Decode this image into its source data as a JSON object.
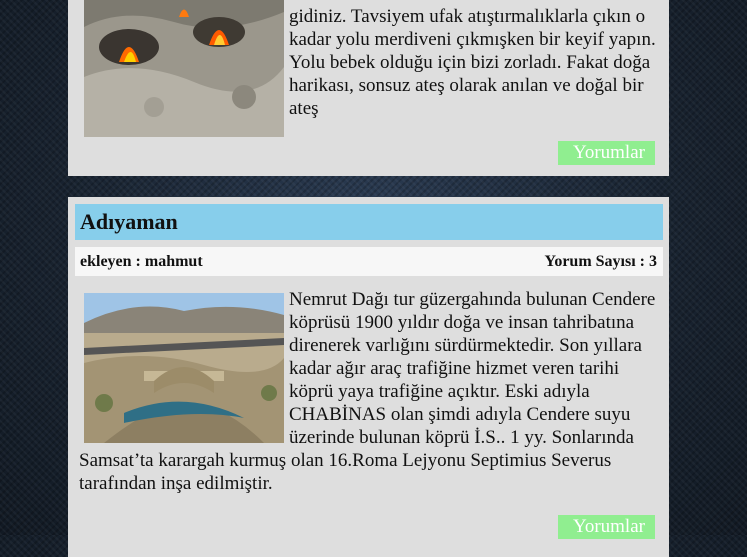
{
  "posts": [
    {
      "body": "gidiniz. Tavsiyem ufak atıştırmalıklarla çıkın o kadar yolu merdiveni çıkmışken bir keyif yapın. Yolu bebek olduğu için bizi zorladı. Fakat doğa harikası, sonsuz ateş olarak anılan ve doğal bir ateş",
      "comments_label": "Yorumlar"
    },
    {
      "title": "Adıyaman",
      "author": "ekleyen : mahmut",
      "comment_count": "Yorum Sayısı : 3",
      "body": "Nemrut Dağı tur güzergahında bulunan Cendere köprüsü 1900 yıldır doğa ve insan tahribatına direnerek varlığını sürdürmektedir. Son yıllara kadar ağır araç trafiğine hizmet veren tarihi köprü yaya trafiğine açıktır. Eski adıyla CHABİNAS olan şimdi adıyla Cendere suyu üzerinde bulunan köprü İ.S.. 1 yy. Sonlarında Samsat’ta karargah kurmuş olan 16.Roma Lejyonu Septimius Severus tarafından inşa edilmiştir.",
      "comments_label": "Yorumlar"
    }
  ]
}
